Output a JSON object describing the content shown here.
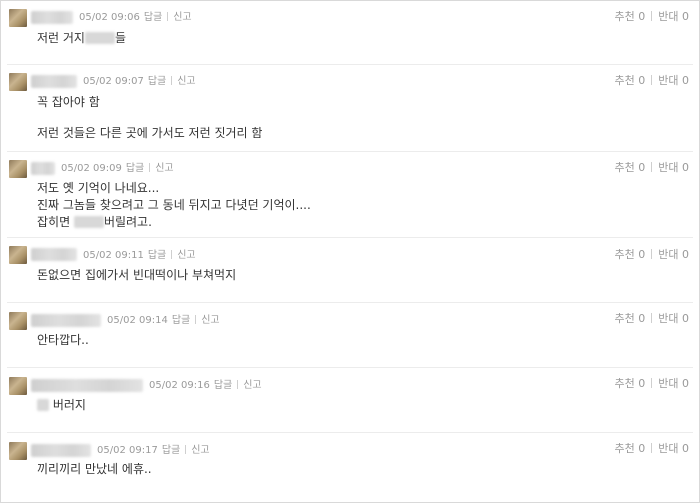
{
  "labels": {
    "reply": "답글",
    "report": "신고",
    "recommend": "추천",
    "oppose": "반대"
  },
  "comments": [
    {
      "time": "05/02 09:06",
      "recommend": "0",
      "oppose": "0",
      "lines": [
        {
          "pre": "저런 거지",
          "post": "들"
        }
      ]
    },
    {
      "time": "05/02 09:07",
      "recommend": "0",
      "oppose": "0",
      "lines": [
        {
          "text": "꼭 잡아야 함"
        },
        {
          "text": "저런 것들은 다른 곳에 가서도 저런 짓거리 함"
        }
      ]
    },
    {
      "time": "05/02 09:09",
      "recommend": "0",
      "oppose": "0",
      "lines": [
        {
          "text": "저도 옛 기억이 나네요..."
        },
        {
          "text": "진짜 그놈들 찾으려고 그 동네 뒤지고 다녓던 기억이...."
        },
        {
          "pre": "잡히면 ",
          "post": "버릴려고."
        }
      ]
    },
    {
      "time": "05/02 09:11",
      "recommend": "0",
      "oppose": "0",
      "lines": [
        {
          "text": "돈없으면 집에가서 빈대떡이나 부쳐먹지"
        }
      ]
    },
    {
      "time": "05/02 09:14",
      "recommend": "0",
      "oppose": "0",
      "lines": [
        {
          "text": "안타깝다.."
        }
      ]
    },
    {
      "time": "05/02 09:16",
      "recommend": "0",
      "oppose": "0",
      "lines": [
        {
          "post": " 버러지"
        }
      ]
    },
    {
      "time": "05/02 09:17",
      "recommend": "0",
      "oppose": "0",
      "lines": [
        {
          "text": "끼리끼리 만났네 에휴.."
        }
      ]
    }
  ]
}
